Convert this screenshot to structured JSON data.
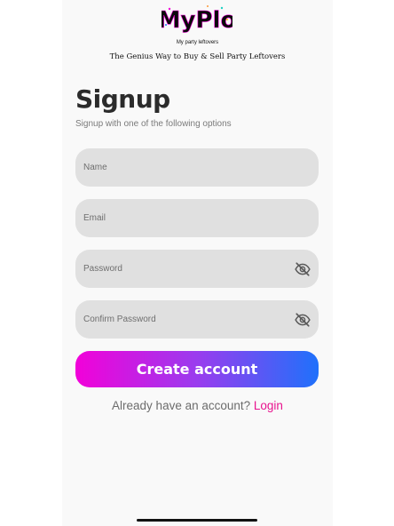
{
  "logo": {
    "text": "MyPlo",
    "subtitle": "My party leftovers"
  },
  "tagline": "The Genius Way to Buy & Sell Party Leftovers",
  "heading": "Signup",
  "subheading": "Signup with one of the following options",
  "form": {
    "name": {
      "placeholder": "Name"
    },
    "email": {
      "placeholder": "Email"
    },
    "password": {
      "placeholder": "Password",
      "icon": "eye-off-icon"
    },
    "confirm_password": {
      "placeholder": "Confirm Password",
      "icon": "eye-off-icon"
    },
    "submit_label": "Create account"
  },
  "login_prompt": {
    "text": "Already have an account?",
    "link": "Login"
  },
  "colors": {
    "gradient_start": "#f201d9",
    "gradient_end": "#1f71fb",
    "link": "#e8138e",
    "field_bg": "#e0e0e0"
  }
}
